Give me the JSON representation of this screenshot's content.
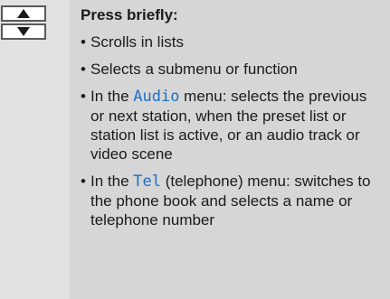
{
  "keys": {
    "up_icon": "arrow-up-triangle",
    "down_icon": "arrow-down-triangle"
  },
  "heading": "Press briefly:",
  "items": [
    {
      "text": "Scrolls in lists"
    },
    {
      "text": "Selects a submenu or function"
    },
    {
      "pre": "In the ",
      "keyword": "Audio",
      "post": " menu: selects the previous or next station, when the preset list or station list is active, or an audio track or video scene"
    },
    {
      "pre": "In the ",
      "keyword": "Tel",
      "post": " (telephone) menu: switches to the phone book and selects a name or telephone number"
    }
  ],
  "colors": {
    "keyword": "#1e6fc7",
    "text_panel": "#d6d6d6",
    "key_panel": "#e2e2e2"
  }
}
